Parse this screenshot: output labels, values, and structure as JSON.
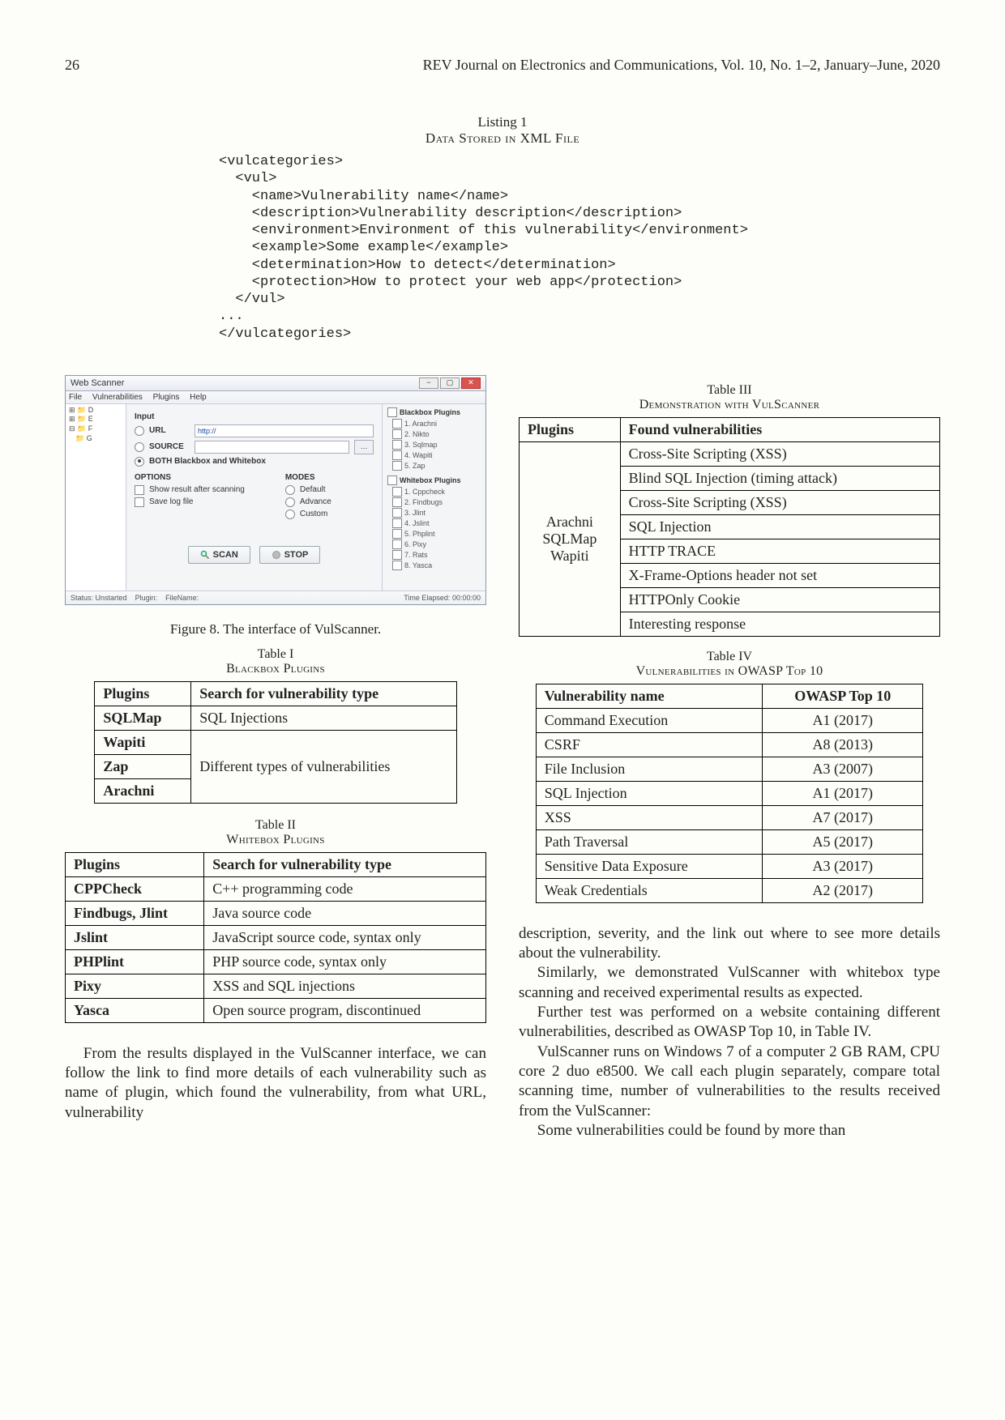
{
  "header": {
    "page_number": "26",
    "journal": "REV Journal on Electronics and Communications, Vol. 10, No. 1–2, January–June, 2020"
  },
  "listing": {
    "label": "Listing 1",
    "caption": "Data Stored in XML File"
  },
  "code": "<vulcategories>\n  <vul>\n    <name>Vulnerability name</name>\n    <description>Vulnerability description</description>\n    <environment>Environment of this vulnerability</environment>\n    <example>Some example</example>\n    <determination>How to detect</determination>\n    <protection>How to protect your web app</protection>\n  </vul>\n...\n</vulcategories>",
  "app": {
    "title": "Web Scanner",
    "menus": [
      "File",
      "Vulnerabilities",
      "Plugins",
      "Help"
    ],
    "tree": [
      "⊞ 📁 D",
      "⊞ 📁 E",
      "⊟ 📁 F",
      "   📁 G"
    ],
    "input_section": "Input",
    "url_label": "URL",
    "url_value": "http://",
    "source_label": "SOURCE",
    "both_label": "BOTH Blackbox and Whitebox",
    "options_title": "OPTIONS",
    "opt_show": "Show result after scanning",
    "opt_log": "Save log file",
    "modes_title": "MODES",
    "mode_default": "Default",
    "mode_advance": "Advance",
    "mode_custom": "Custom",
    "scan_btn": "SCAN",
    "stop_btn": "STOP",
    "blackbox_title": "Blackbox Plugins",
    "blackbox_items": [
      "1. Arachni",
      "2. Nikto",
      "3. Sqlmap",
      "4. Wapiti",
      "5. Zap"
    ],
    "whitebox_title": "Whitebox Plugins",
    "whitebox_items": [
      "1. Cppcheck",
      "2. Findbugs",
      "3. Jlint",
      "4. Jslint",
      "5. Phplint",
      "6. Pixy",
      "7. Rats",
      "8. Yasca"
    ],
    "status_status": "Status:",
    "status_status_val": "Unstarted",
    "status_plugin": "Plugin:",
    "status_filename": "FileName:",
    "status_elapsed": "Time Elapsed:",
    "status_elapsed_val": "00:00:00"
  },
  "fig8": "Figure 8. The interface of VulScanner.",
  "table1": {
    "label": "Table I",
    "caption": "Blackbox Plugins",
    "h1": "Plugins",
    "h2": "Search for vulnerability type",
    "r1c1": "SQLMap",
    "r1c2": "SQL Injections",
    "r2c1": "Wapiti",
    "r3c1": "Zap",
    "r3c2": "Different types of vulnerabilities",
    "r4c1": "Arachni"
  },
  "table2": {
    "label": "Table II",
    "caption": "Whitebox Plugins",
    "h1": "Plugins",
    "h2": "Search for vulnerability type",
    "rows": [
      [
        "CPPCheck",
        "C++ programming code"
      ],
      [
        "Findbugs, Jlint",
        "Java source code"
      ],
      [
        "Jslint",
        "JavaScript source code, syntax only"
      ],
      [
        "PHPlint",
        "PHP source code, syntax only"
      ],
      [
        "Pixy",
        "XSS and SQL injections"
      ],
      [
        "Yasca",
        "Open source program, discontinued"
      ]
    ]
  },
  "table3": {
    "label": "Table III",
    "caption": "Demonstration with VulScanner",
    "h1": "Plugins",
    "h2": "Found vulnerabilities",
    "plugins_cell": "Arachni\nSQLMap\nWapiti",
    "vulns": [
      "Cross-Site Scripting (XSS)",
      "Blind SQL Injection (timing attack)",
      "Cross-Site Scripting (XSS)",
      "SQL Injection",
      "HTTP TRACE",
      "X-Frame-Options header not set",
      "HTTPOnly Cookie",
      "Interesting response"
    ]
  },
  "table4": {
    "label": "Table IV",
    "caption": "Vulnerabilities in OWASP Top 10",
    "h1": "Vulnerability name",
    "h2": "OWASP Top 10",
    "rows": [
      [
        "Command Execution",
        "A1 (2017)"
      ],
      [
        "CSRF",
        "A8 (2013)"
      ],
      [
        "File Inclusion",
        "A3 (2007)"
      ],
      [
        "SQL Injection",
        "A1 (2017)"
      ],
      [
        "XSS",
        "A7 (2017)"
      ],
      [
        "Path Traversal",
        "A5 (2017)"
      ],
      [
        "Sensitive Data Exposure",
        "A3 (2017)"
      ],
      [
        "Weak Credentials",
        "A2 (2017)"
      ]
    ]
  },
  "left_text": "From the results displayed in the VulScanner interface, we can follow the link to find more details of each vulnerability such as name of plugin, which found the vulnerability, from what URL, vulnerability",
  "right_text": {
    "p1": "description, severity, and the link out where to see more details about the vulnerability.",
    "p2": "Similarly, we demonstrated VulScanner with whitebox type scanning and received experimental results as expected.",
    "p3": "Further test was performed on a website containing different vulnerabilities, described as OWASP Top 10, in Table IV.",
    "p4": "VulScanner runs on Windows 7 of a computer 2 GB RAM, CPU core 2 duo e8500. We call each plugin separately, compare total scanning time, number of vulnerabilities to the results received from the VulScanner:",
    "p5": "Some vulnerabilities could be found by more than"
  }
}
